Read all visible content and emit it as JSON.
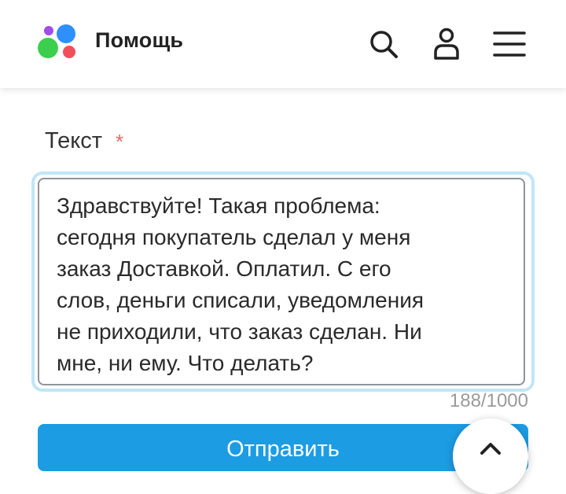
{
  "header": {
    "title": "Помощь",
    "logo_colors": [
      "#2e90ff",
      "#a14dea",
      "#3ccf4e",
      "#f04f5b"
    ],
    "icons": [
      "search-icon",
      "user-icon",
      "menu-icon"
    ]
  },
  "form": {
    "text_label": "Текст",
    "required_mark": "*",
    "text_value": "Здравствуйте! Такая проблема:\nсегодня покупатель сделал у меня\nзаказ Доставкой. Оплатил. С его\nслов, деньги списали, уведомления\nне приходили, что заказ сделан. Ни\nмне, ни ему. Что делать?",
    "char_counter": "188/1000",
    "submit_label": "Отправить"
  },
  "colors": {
    "accent": "#1c9ce3",
    "focus_ring": "#bfe6f7",
    "required": "#e86a6a"
  }
}
